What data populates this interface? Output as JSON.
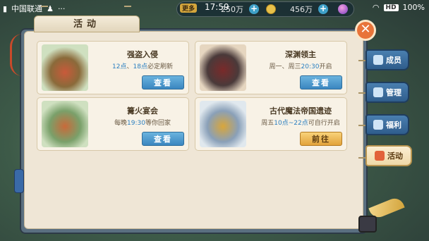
{
  "status": {
    "carrier": "中国联通",
    "time": "17:59",
    "battery": "100%",
    "hd": "HD",
    "dots": "···"
  },
  "resources": {
    "more_label": "更多",
    "silver": "250万",
    "gold": "456万"
  },
  "panel": {
    "title": "活动",
    "close_symbol": "✕"
  },
  "cards": [
    {
      "name": "强盗入侵",
      "desc_parts": [
        "12点",
        "、",
        "18点",
        "必定刷新"
      ],
      "button": "查看",
      "button_style": "blue"
    },
    {
      "name": "深渊领主",
      "desc_parts": [
        "周一、周三",
        "20:30",
        "开启"
      ],
      "button": "查看",
      "button_style": "blue"
    },
    {
      "name": "篝火宴会",
      "desc_parts": [
        "每晚",
        "19:30",
        "等你回家"
      ],
      "button": "查看",
      "button_style": "blue"
    },
    {
      "name": "古代魔法帝国遗迹",
      "desc_parts": [
        "周五",
        "10点~22点",
        "可自行开启"
      ],
      "button": "前往",
      "button_style": "gold"
    }
  ],
  "side_tabs": [
    {
      "label": "成员",
      "icon": "members-icon",
      "active": false
    },
    {
      "label": "管理",
      "icon": "megaphone-icon",
      "active": false
    },
    {
      "label": "福利",
      "icon": "gift-box-icon",
      "active": false
    },
    {
      "label": "活动",
      "icon": "gift-icon",
      "active": true
    }
  ],
  "colors": {
    "highlight_text": "#2b7fc0",
    "button_blue": "#3a86c0",
    "button_gold": "#e2a23a",
    "close_orange": "#e8743a"
  }
}
